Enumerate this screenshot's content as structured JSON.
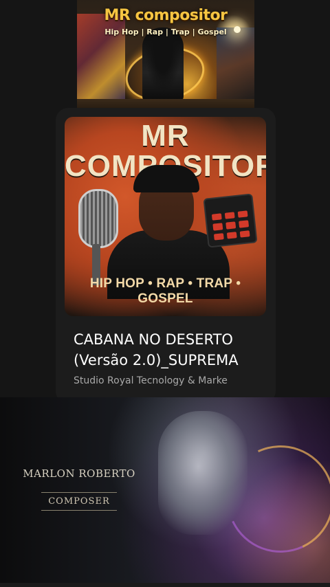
{
  "top_banner": {
    "title": "MR compositor",
    "subtitle": "Hip Hop | Rap | Trap | Gospel"
  },
  "player": {
    "cover": {
      "title_line1": "MR",
      "title_line2": "COMPOSITOR",
      "tags": "HIP HOP • RAP • TRAP • GOSPEL"
    },
    "song_title_line1": "CABANA NO DESERTO",
    "song_title_line2": "(Versão 2.0)_SUPREMA",
    "artist": "Studio Royal Tecnology & Marke"
  },
  "bottom_banner": {
    "name": "MARLON ROBERTO",
    "role": "COMPOSER"
  },
  "colors": {
    "background": "#151515",
    "card": "#1c1c1c",
    "gold": "#f6c542",
    "cover_orange": "#b5451f"
  }
}
